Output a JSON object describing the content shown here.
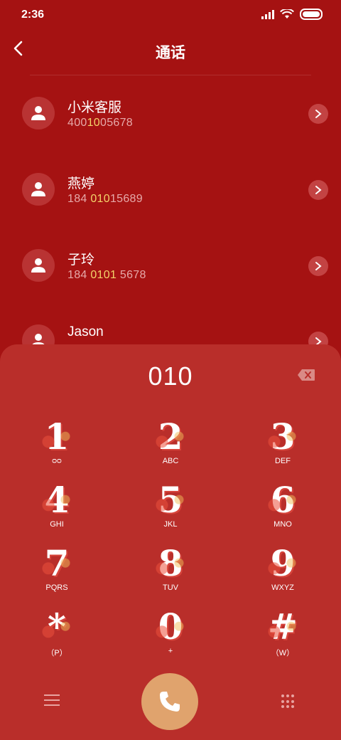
{
  "status": {
    "time": "2:36"
  },
  "header": {
    "title": "通话"
  },
  "contacts": [
    {
      "name": "小米客服",
      "number_pre": "400",
      "number_hl": "10",
      "number_post": "05678"
    },
    {
      "name": "燕婷",
      "number_pre": "184 ",
      "number_hl": "010",
      "number_post": "15689"
    },
    {
      "name": "子玲",
      "number_pre": "184 ",
      "number_hl": "0101",
      "number_post": " 5678"
    },
    {
      "name": "Jason",
      "number_pre": "",
      "number_hl": "",
      "number_post": ""
    }
  ],
  "dialer": {
    "input": "010",
    "keys": [
      {
        "digit": "1",
        "sub": "ᴑᴑ"
      },
      {
        "digit": "2",
        "sub": "ABC"
      },
      {
        "digit": "3",
        "sub": "DEF"
      },
      {
        "digit": "4",
        "sub": "GHI"
      },
      {
        "digit": "5",
        "sub": "JKL"
      },
      {
        "digit": "6",
        "sub": "MNO"
      },
      {
        "digit": "7",
        "sub": "PQRS"
      },
      {
        "digit": "8",
        "sub": "TUV"
      },
      {
        "digit": "9",
        "sub": "WXYZ"
      },
      {
        "digit": "*",
        "sub": "（P）"
      },
      {
        "digit": "0",
        "sub": "+"
      },
      {
        "digit": "#",
        "sub": "（W）"
      }
    ]
  },
  "icons": {
    "back": "chevron-left-icon",
    "avatar": "person-icon",
    "chevron": "chevron-right-icon",
    "backspace": "backspace-icon",
    "menu": "menu-icon",
    "call": "phone-icon",
    "keypad": "keypad-icon"
  },
  "colors": {
    "background": "#a51212",
    "dialer": "#b92e2a",
    "highlight": "#f3d46a",
    "call": "#e0a36d"
  }
}
